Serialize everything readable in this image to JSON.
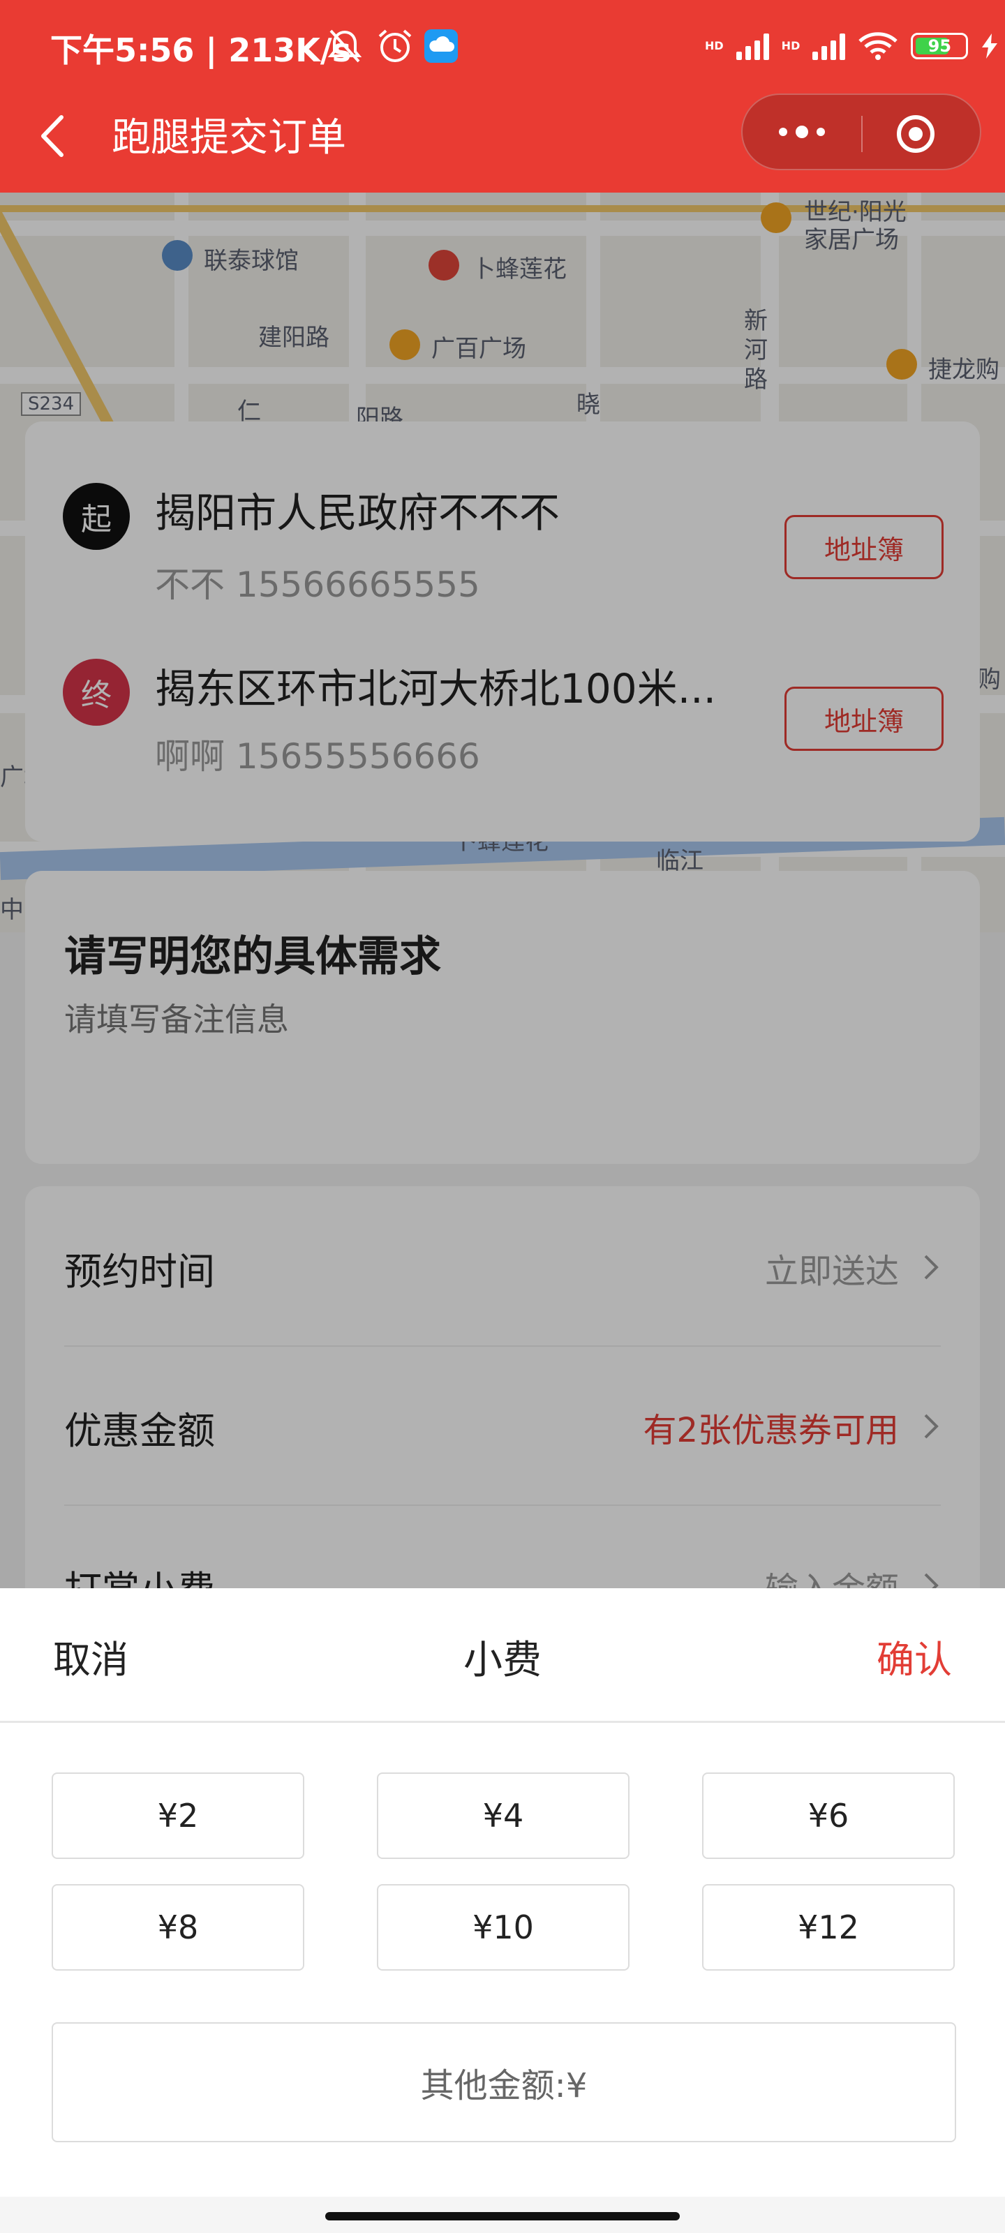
{
  "status_bar": {
    "time_speed": "下午5:56 | 213K/s",
    "hd1": "HD",
    "hd2": "HD",
    "battery": "95"
  },
  "header": {
    "title": "跑腿提交订单"
  },
  "map": {
    "labels": [
      "联泰球馆",
      "卜蜂莲花",
      "建阳路",
      "广百广场",
      "世纪·阳光",
      "家居广场",
      "新",
      "河",
      "路",
      "捷龙购",
      "S234",
      "晓",
      "仁",
      "阳路",
      "卜蜂莲花",
      "临江",
      "购",
      "广场",
      "中"
    ]
  },
  "addresses": {
    "start": {
      "badge": "起",
      "name": "揭阳市人民政府不不不",
      "contact": "不不 15566665555",
      "book_label": "地址簿"
    },
    "end": {
      "badge": "终",
      "name": "揭东区环市北河大桥北100米...",
      "contact": "啊啊 15655556666",
      "book_label": "地址簿"
    }
  },
  "requirement": {
    "title": "请写明您的具体需求",
    "placeholder": "请填写备注信息"
  },
  "options": {
    "schedule": {
      "label": "预约时间",
      "value": "立即送达"
    },
    "discount": {
      "label": "优惠金额",
      "value": "有2张优惠券可用"
    },
    "tip": {
      "label": "打赏小费",
      "value": "输入金额"
    }
  },
  "sheet": {
    "cancel": "取消",
    "title": "小费",
    "confirm": "确认",
    "amounts": [
      "¥2",
      "¥4",
      "¥6",
      "¥8",
      "¥10",
      "¥12"
    ],
    "other": "其他金额:¥"
  },
  "colors": {
    "brand_red": "#e93b33",
    "accent_red": "#e23d35"
  }
}
